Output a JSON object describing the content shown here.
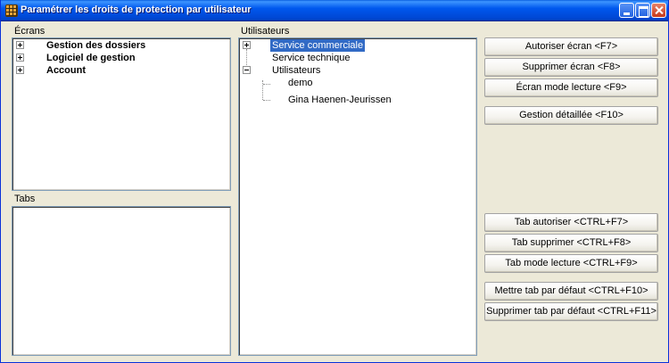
{
  "window": {
    "title": "Paramétrer les droits de protection par utilisateur"
  },
  "ecrans": {
    "label": "Écrans",
    "items": [
      {
        "label": "Gestion des dossiers",
        "expander": "plus"
      },
      {
        "label": "Logiciel de gestion",
        "expander": "plus"
      },
      {
        "label": "Account",
        "expander": "plus"
      }
    ]
  },
  "tabs_panel": {
    "label": "Tabs"
  },
  "utilisateurs": {
    "label": "Utilisateurs",
    "items": [
      {
        "label": "Service commerciale",
        "expander": "plus",
        "selected": true
      },
      {
        "label": "Service technique"
      },
      {
        "label": "Utilisateurs",
        "expander": "minus",
        "children": [
          {
            "label": "demo"
          },
          {
            "label": "Gina Haenen-Jeurissen"
          }
        ]
      }
    ]
  },
  "buttons": {
    "autoriser_ecran": "Autoriser écran <F7>",
    "supprimer_ecran": "Supprimer écran <F8>",
    "ecran_lecture": "Écran mode lecture <F9>",
    "gestion_detaillee": "Gestion détaillée <F10>",
    "tab_autoriser": "Tab autoriser <CTRL+F7>",
    "tab_supprimer": "Tab supprimer <CTRL+F8>",
    "tab_lecture": "Tab mode lecture <CTRL+F9>",
    "tab_defaut": "Mettre tab par défaut <CTRL+F10>",
    "supprimer_tab_defaut": "Supprimer tab par défaut <CTRL+F11>"
  },
  "colors": {
    "titlebar": "#0058ee",
    "window_bg": "#ece9d8",
    "selection": "#316ac5",
    "panel_border": "#7f9db9"
  },
  "icons": {
    "app": "grid-icon",
    "minimize": "minimize-icon",
    "maximize": "maximize-icon",
    "close": "close-icon"
  }
}
